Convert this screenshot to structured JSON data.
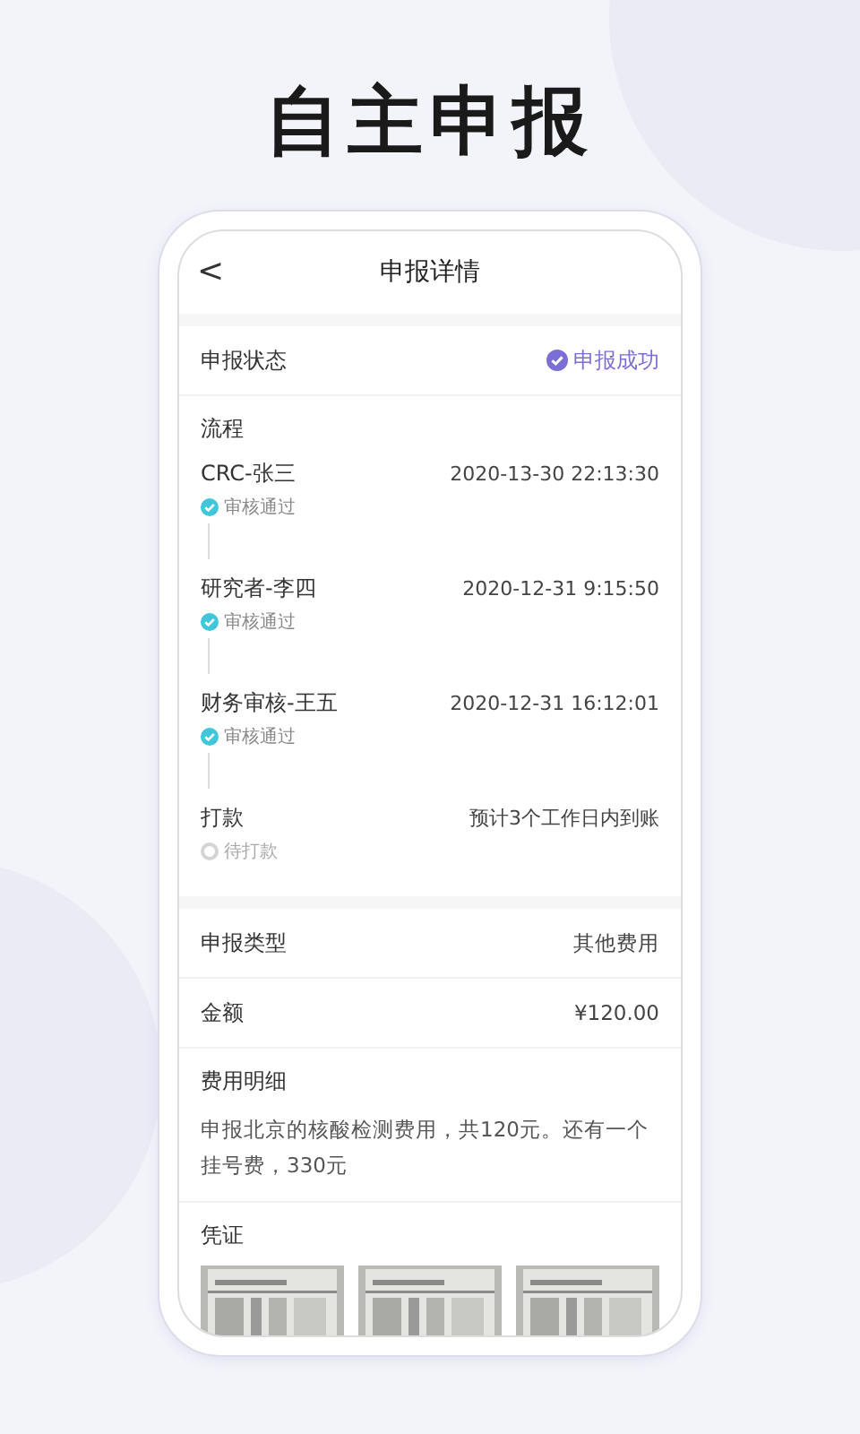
{
  "headline": "自主申报",
  "screen": {
    "title": "申报详情",
    "back": "<",
    "status": {
      "label": "申报状态",
      "value": "申报成功"
    },
    "flow": {
      "label": "流程",
      "steps": [
        {
          "name": "CRC-张三",
          "time": "2020-13-30 22:13:30",
          "state": "审核通过",
          "kind": "passed"
        },
        {
          "name": "研究者-李四",
          "time": "2020-12-31 9:15:50",
          "state": "审核通过",
          "kind": "passed"
        },
        {
          "name": "财务审核-王五",
          "time": "2020-12-31 16:12:01",
          "state": "审核通过",
          "kind": "passed"
        },
        {
          "name": "打款",
          "time": "预计3个工作日内到账",
          "state": "待打款",
          "kind": "pending"
        }
      ]
    },
    "type": {
      "label": "申报类型",
      "value": "其他费用"
    },
    "amount": {
      "label": "金额",
      "value": "¥120.00"
    },
    "detail": {
      "label": "费用明细",
      "text": "申报北京的核酸检测费用，共120元。还有一个挂号费，330元"
    },
    "voucher": {
      "label": "凭证"
    }
  }
}
